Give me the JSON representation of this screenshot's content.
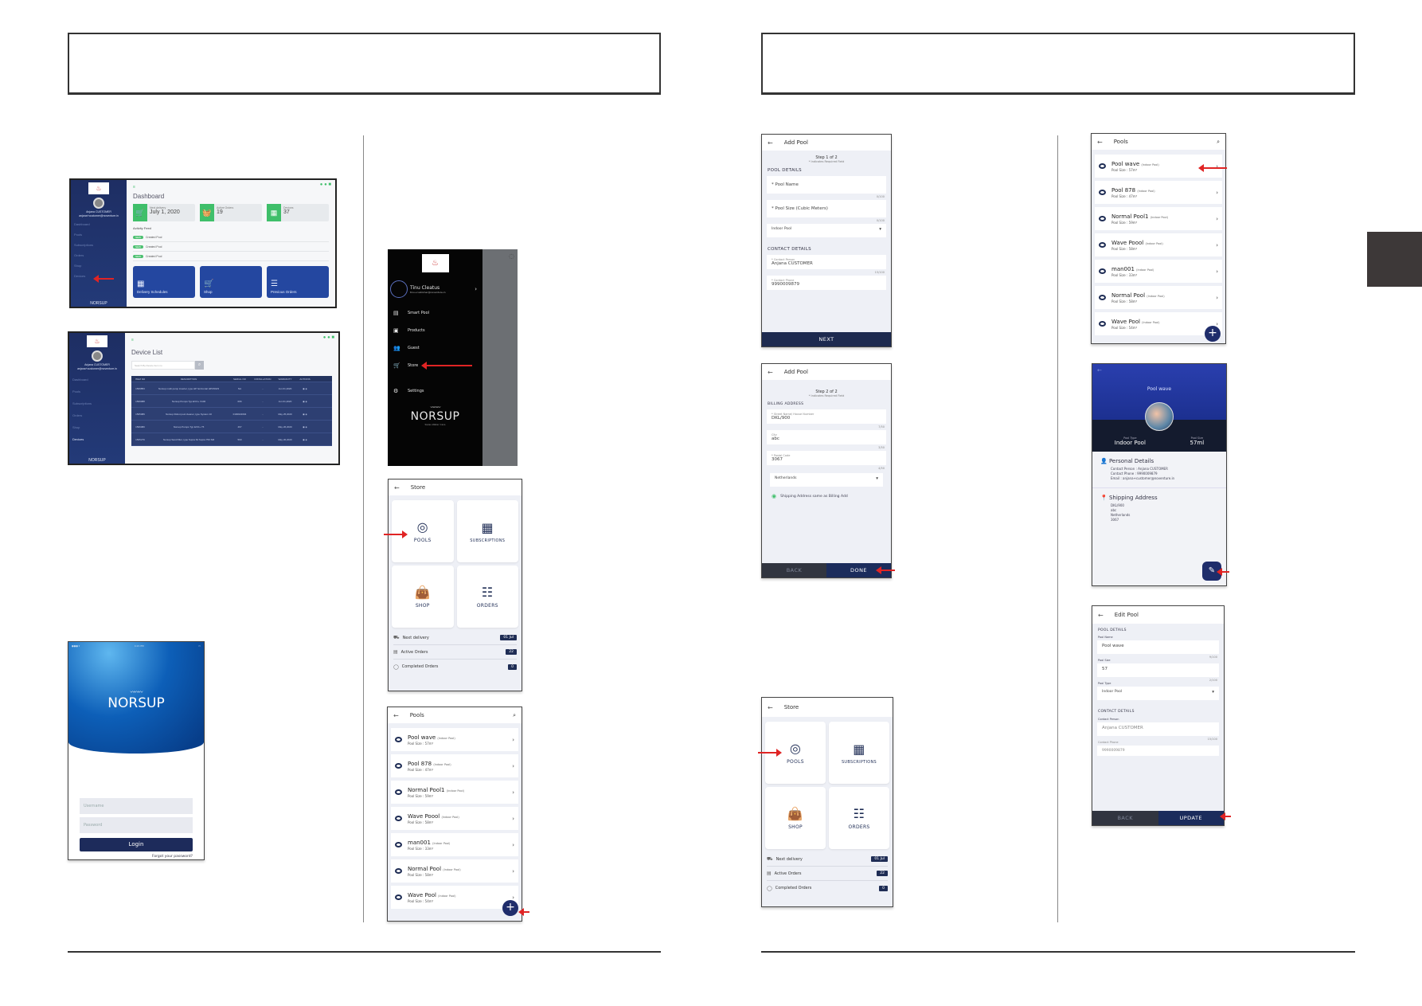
{
  "document": {
    "side_tab_color": "#3d3838",
    "arrow_color": "#e02424"
  },
  "dashboard": {
    "title": "Dashboard",
    "user_name": "Anjana CUSTOMER",
    "user_email": "anjana+customer@noventure.in",
    "nav": [
      "Dashboard",
      "Pools",
      "Subscriptions",
      "Orders",
      "Shop",
      "Devices"
    ],
    "brand": "NORSUP",
    "stats": [
      {
        "icon": "cart-icon",
        "glyph": "🛒",
        "label": "Next delivery",
        "value": "July 1, 2020"
      },
      {
        "icon": "basket-icon",
        "glyph": "🧺",
        "label": "Active Orders",
        "value": "19"
      },
      {
        "icon": "device-icon",
        "glyph": "▦",
        "label": "Devices",
        "value": "37"
      }
    ],
    "activity_feed_label": "Activity Feed",
    "activity": [
      {
        "badge": "NEW",
        "text": "Created Pool"
      },
      {
        "badge": "NEW",
        "text": "Created Pool"
      },
      {
        "badge": "NEW",
        "text": "Created Pool"
      }
    ],
    "tiles": [
      {
        "icon": "calendar-icon",
        "glyph": "▦",
        "label": "Delivery Schedules"
      },
      {
        "icon": "shop-cart-icon",
        "glyph": "🛒",
        "label": "Shop"
      },
      {
        "icon": "orders-icon",
        "glyph": "☰",
        "label": "Previous Orders"
      }
    ]
  },
  "device_list": {
    "title": "Device List",
    "search_placeholder": "Search By Device Item no",
    "columns": [
      "ITEM NO",
      "DESCRIPTION",
      "SERIAL NO",
      "INSTALLATION",
      "WARRANTY",
      "ACTIONS"
    ],
    "rows": [
      [
        "1509853",
        "Norsup multi pump inverter, type HP horizontal HP1500/3",
        "NA",
        "-",
        "Jun 01,2020"
      ],
      [
        "1509088",
        "Norsup Pumps Typ EVO+ V100",
        "066",
        "-",
        "Jun 01,2020"
      ],
      [
        "1505089",
        "Norsup Robot pool cleaner, type System 10",
        "0190022094",
        "-",
        "May 25,2020"
      ],
      [
        "1506080",
        "Norsup Pumps Typ EVO+ 75",
        "467",
        "-",
        "May 26,2020"
      ],
      [
        "1505279",
        "Norsup Sand filter, type Supra 64 Supra 750 SM",
        "560",
        "-",
        "May 20,2020"
      ]
    ]
  },
  "login": {
    "brand": "NORSUP",
    "username_placeholder": "Username",
    "password_placeholder": "Password",
    "login_label": "Login",
    "forgot_label": "Forgot your password?"
  },
  "drawer": {
    "user_name": "Tinu Cleatus",
    "user_email": "tinu+customer@noventure.in",
    "items": [
      {
        "icon": "smart-pool-icon",
        "glyph": "▤",
        "label": "Smart Pool"
      },
      {
        "icon": "products-icon",
        "glyph": "▣",
        "label": "Products"
      },
      {
        "icon": "guest-icon",
        "glyph": "👥",
        "label": "Guest"
      },
      {
        "icon": "store-icon",
        "glyph": "🛒",
        "label": "Store"
      }
    ],
    "settings_label": "Settings",
    "brand": "NORSUP",
    "brand_sub": "Swiss Water Care"
  },
  "store": {
    "title": "Store",
    "tiles": [
      {
        "icon": "pools-icon",
        "glyph": "◎",
        "label": "POOLS"
      },
      {
        "icon": "subscriptions-icon",
        "glyph": "▦",
        "label": "SUBSCRIPTIONS"
      },
      {
        "icon": "shop-bag-icon",
        "glyph": "👜",
        "label": "SHOP"
      },
      {
        "icon": "orders-icon",
        "glyph": "☷",
        "label": "ORDERS"
      }
    ],
    "rows": [
      {
        "icon": "truck-icon",
        "glyph": "⛟",
        "label": "Next delivery",
        "badge": "01 Jul"
      },
      {
        "icon": "active-orders-icon",
        "glyph": "▤",
        "label": "Active Orders",
        "badge": "22"
      },
      {
        "icon": "check-circle-icon",
        "glyph": "◯",
        "label": "Completed Orders",
        "badge": "0"
      }
    ]
  },
  "pools": {
    "title": "Pools",
    "items": [
      {
        "name": "Pool wave",
        "type": "(Indoor Pool)",
        "size": "Pool Size : 57m³"
      },
      {
        "name": "Pool 878",
        "type": "(Indoor Pool)",
        "size": "Pool Size : 47m³"
      },
      {
        "name": "Normal Pool1",
        "type": "(Indoor Pool)",
        "size": "Pool Size : 59m³"
      },
      {
        "name": "Wave Poool",
        "type": "(Indoor Pool)",
        "size": "Pool Size : 58m³"
      },
      {
        "name": "man001",
        "type": "(Indoor Pool)",
        "size": "Pool Size : 33m³"
      },
      {
        "name": "Normal Pool",
        "type": "(Indoor Pool)",
        "size": "Pool Size : 58m³"
      },
      {
        "name": "Wave Pool",
        "type": "(Indoor Pool)",
        "size": "Pool Size : 54m³"
      }
    ]
  },
  "add_pool_1": {
    "title": "Add Pool",
    "step": "Step 1 of 2",
    "required_note": "* Indicates Required Field",
    "pool_details": "POOL DETAILS",
    "pool_name_placeholder": "* Pool Name",
    "pool_name_count": "0/100",
    "pool_size_placeholder": "* Pool Size (Cubic Meters)",
    "pool_size_count": "0/100",
    "pool_type": "Indoor Pool",
    "contact_details": "CONTACT DETAILS",
    "contact_person_label": "* Contact Person",
    "contact_person": "Anjana CUSTOMER",
    "contact_person_count": "15/100",
    "contact_phone_label": "* Contact Phone",
    "contact_phone": "9990009879",
    "next_label": "NEXT"
  },
  "add_pool_2": {
    "title": "Add Pool",
    "step": "Step 2 of 2",
    "required_note": "* Indicates Required Field",
    "billing_address": "BILLING ADDRESS",
    "street_label": "* Street Name/ House Number",
    "street": "DKL/900",
    "street_count": "7/50",
    "city_label": "City",
    "city": "abc",
    "city_count": "3/50",
    "postal_label": "* Postal Code",
    "postal": "3067",
    "postal_count": "4/50",
    "country": "Netherlands",
    "same_address_label": "Shipping Address same as Billing Add",
    "back_label": "BACK",
    "done_label": "DONE"
  },
  "pool_detail": {
    "title": "Pool wave",
    "type_label": "Pool Type",
    "type": "Indoor Pool",
    "size_label": "Pool Size",
    "size": "57ml",
    "personal_details": "Personal Details",
    "contact_person": "Contact Person : Anjana CUSTOMER",
    "contact_phone": "Contact Phone : 9990009879",
    "email": "Email : anjana+customer@noventure.in",
    "shipping_address": "Shipping Address",
    "address_lines": [
      "DKL/900",
      "abc",
      "Netherlands",
      "3067"
    ]
  },
  "edit_pool": {
    "title": "Edit Pool",
    "pool_details": "POOL DETAILS",
    "pool_name_label": "Pool Name",
    "pool_name": "Pool wave",
    "pool_name_count": "9/100",
    "pool_size_label": "Pool Size",
    "pool_size": "57",
    "pool_size_count": "2/100",
    "pool_type_label": "Pool Type",
    "pool_type": "Indoor Pool",
    "contact_details": "CONTACT DETAILS",
    "contact_person_label": "Contact Person",
    "contact_person": "Anjana CUSTOMER",
    "contact_person_count": "15/100",
    "contact_phone_label": "Contact Phone",
    "contact_phone": "9990009879",
    "back_label": "BACK",
    "update_label": "UPDATE"
  }
}
